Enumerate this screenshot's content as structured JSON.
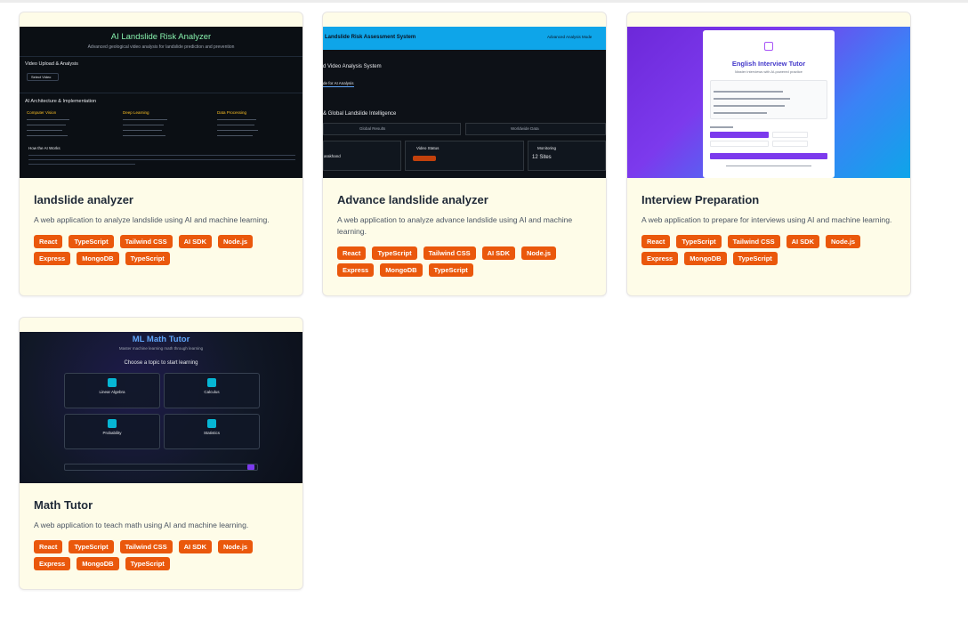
{
  "projects": [
    {
      "title": "landslide analyzer",
      "description": "A web application to analyze landslide using AI and machine learning.",
      "tags": [
        "React",
        "TypeScript",
        "Tailwind CSS",
        "AI SDK",
        "Node.js",
        "Express",
        "MongoDB",
        "TypeScript"
      ],
      "preview": {
        "heading": "AI Landslide Risk Analyzer",
        "subheading": "Advanced geological video analysis for landslide prediction and prevention",
        "upload_section": "Video Upload & Analysis",
        "upload_button": "Select Video",
        "arch_section": "AI Architecture & Implementation",
        "col1": "Computer Vision",
        "col2": "Deep Learning",
        "col3": "Data Processing",
        "how_it_works": "How the AI Works"
      }
    },
    {
      "title": "Advance landslide analyzer",
      "description": "A web application to analyze advance landslide using AI and machine learning.",
      "tags": [
        "React",
        "TypeScript",
        "Tailwind CSS",
        "AI SDK",
        "Node.js",
        "Express",
        "MongoDB",
        "TypeScript"
      ],
      "preview": {
        "bar_title": "Landslide Risk Assessment System",
        "bar_right": "Advanced Analysis Mode",
        "section1": "d Video Analysis System",
        "tab": "de for AI Analysis",
        "section2": "& Global Landslide Intelligence",
        "btn1": "Global Results",
        "btn2": "Worldwide Data",
        "stat1_label": "arakhand",
        "stat2_label": "Video Status",
        "stat3_label": "Monitoring",
        "stat3_value": "12 Sites"
      }
    },
    {
      "title": "Interview Preparation",
      "description": "A web application to prepare for interviews using AI and machine learning.",
      "tags": [
        "React",
        "TypeScript",
        "Tailwind CSS",
        "AI SDK",
        "Node.js",
        "Express",
        "MongoDB",
        "TypeScript"
      ],
      "preview": {
        "heading": "English Interview Tutor",
        "subheading": "Master interviews with AI-powered practice"
      }
    },
    {
      "title": "Math Tutor",
      "description": "A web application to teach math using AI and machine learning.",
      "tags": [
        "React",
        "TypeScript",
        "Tailwind CSS",
        "AI SDK",
        "Node.js",
        "Express",
        "MongoDB",
        "TypeScript"
      ],
      "preview": {
        "heading": "ML Math Tutor",
        "subheading": "Master machine learning math through learning",
        "choose": "Choose a topic to start learning",
        "topics": [
          "Linear Algebra",
          "Calculus",
          "Probability",
          "Statistics"
        ]
      }
    }
  ],
  "colors": {
    "tag_bg": "#ea580c",
    "card_bg": "#fefce8"
  }
}
